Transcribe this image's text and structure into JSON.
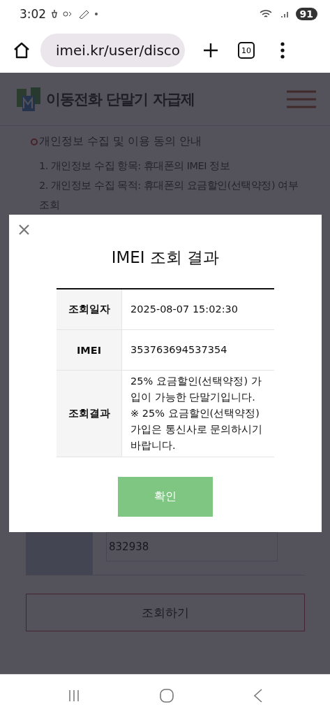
{
  "status_bar": {
    "time": "3:02",
    "battery": "91"
  },
  "browser": {
    "url": "imei.kr/user/disco",
    "tab_count": "10"
  },
  "site": {
    "title": "이동전화 단말기 자급제",
    "notice_heading": "개인정보 수집 및 이용 동의 안내",
    "notice_items": [
      "1. 개인정보 수집 항목: 휴대폰의 IMEI 정보",
      "2. 개인정보 수집 목적: 휴대폰의 요금할인(선택약정) 여부 조회"
    ],
    "code_field": {
      "value": "832938"
    },
    "submit_button": "조회하기"
  },
  "modal": {
    "title": "IMEI 조회 결과",
    "rows": [
      {
        "label": "조회일자",
        "lines": [
          "2025-08-07 15:02:30"
        ]
      },
      {
        "label": "IMEI",
        "lines": [
          "353763694537354"
        ]
      },
      {
        "label": "조회결과",
        "lines": [
          "25% 요금할인(선택약정) 가입이 가능한 단말기입니다.",
          "※ 25% 요금할인(선택약정) 가입은 통신사로 문의하시기 바랍니다."
        ]
      }
    ],
    "confirm_button": "확인"
  }
}
